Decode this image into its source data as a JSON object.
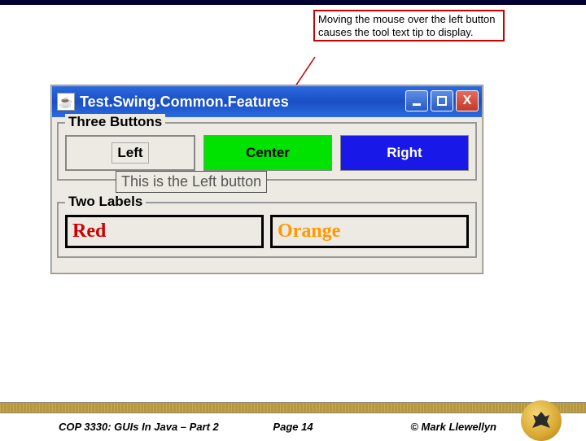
{
  "callout": {
    "text": "Moving the mouse over the left button causes the tool text tip to display."
  },
  "window": {
    "title": "Test.Swing.Common.Features",
    "group1": {
      "title": "Three Buttons",
      "buttons": {
        "left": "Left",
        "center": "Center",
        "right": "Right"
      }
    },
    "tooltip": "This is the Left button",
    "group2": {
      "title": "Two Labels",
      "labels": {
        "red": "Red",
        "orange": "Orange"
      }
    }
  },
  "footer": {
    "left": "COP 3330:  GUIs In Java – Part 2",
    "center": "Page 14",
    "right": "© Mark Llewellyn"
  }
}
